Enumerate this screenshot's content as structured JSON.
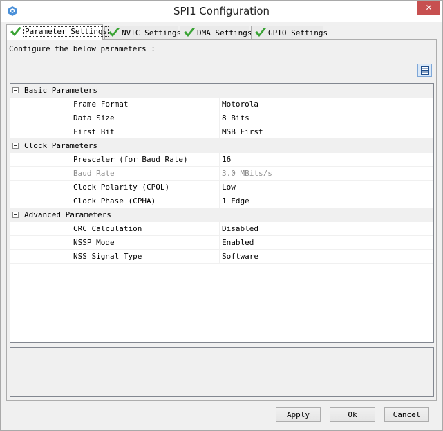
{
  "window": {
    "title": "SPI1 Configuration",
    "close_label": "✕"
  },
  "tabs": [
    {
      "label": "Parameter Settings",
      "active": true
    },
    {
      "label": "NVIC Settings",
      "active": false
    },
    {
      "label": "DMA Settings",
      "active": false
    },
    {
      "label": "GPIO Settings",
      "active": false
    }
  ],
  "panel": {
    "info": "Configure the below parameters :"
  },
  "categories": [
    {
      "label": "Basic Parameters",
      "params": [
        {
          "name": "Frame Format",
          "value": "Motorola",
          "enabled": true
        },
        {
          "name": "Data Size",
          "value": "8 Bits",
          "enabled": true
        },
        {
          "name": "First Bit",
          "value": "MSB First",
          "enabled": true
        }
      ]
    },
    {
      "label": "Clock Parameters",
      "params": [
        {
          "name": "Prescaler (for Baud Rate)",
          "value": "16",
          "enabled": true
        },
        {
          "name": "Baud Rate",
          "value": "3.0 MBits/s",
          "enabled": false
        },
        {
          "name": "Clock Polarity (CPOL)",
          "value": "Low",
          "enabled": true
        },
        {
          "name": "Clock Phase (CPHA)",
          "value": "1 Edge",
          "enabled": true
        }
      ]
    },
    {
      "label": "Advanced Parameters",
      "params": [
        {
          "name": "CRC Calculation",
          "value": "Disabled",
          "enabled": true
        },
        {
          "name": "NSSP Mode",
          "value": "Enabled",
          "enabled": true
        },
        {
          "name": "NSS Signal Type",
          "value": "Software",
          "enabled": true
        }
      ]
    }
  ],
  "buttons": {
    "apply": "Apply",
    "ok": "Ok",
    "cancel": "Cancel"
  },
  "colors": {
    "check": "#3aa335",
    "close": "#c75050",
    "disabled_text": "#8c8c8c"
  },
  "icons": {
    "app": "cube-app-icon",
    "tab": "green-check-icon",
    "view": "list-view-icon"
  }
}
